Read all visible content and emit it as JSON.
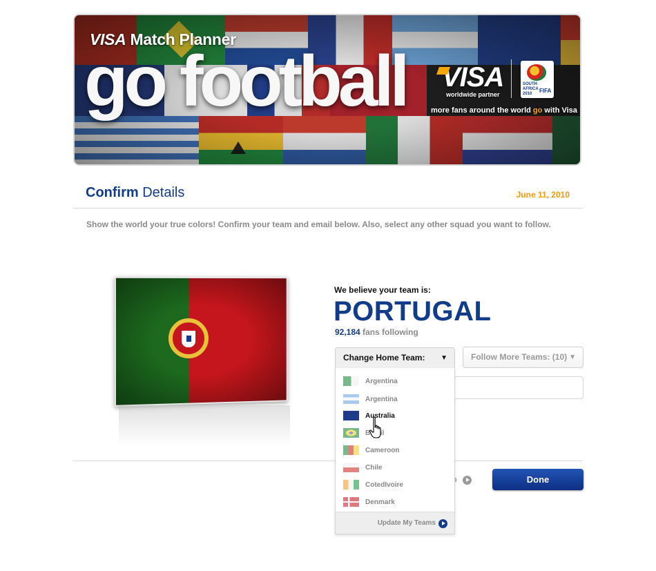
{
  "banner": {
    "visa_word": "VISA",
    "app_name": "Match Planner",
    "headline": "go football",
    "sponsor_logo": "VISA",
    "sponsor_sub": "worldwide partner",
    "tagline_pre": "more fans around the world ",
    "tagline_go": "go",
    "tagline_post": " with Visa",
    "emblem_text": "SOUTH AFRICA 2010",
    "emblem_fifa": "FIFA"
  },
  "header": {
    "title_bold": "Confirm",
    "title_rest": " Details",
    "date": "June 11, 2010"
  },
  "intro": "Show the world your true colors! Confirm your team and email below. Also, select any other squad you want to follow.",
  "team": {
    "believe_label": "We believe your team is:",
    "name": "PORTUGAL",
    "fans_count": "92,184",
    "fans_label": " fans following"
  },
  "controls": {
    "change_home_label": "Change Home Team:",
    "follow_more_label": "Follow More Teams: (10)",
    "arrow": "▼",
    "dropdown_items": [
      {
        "label": "Argentina",
        "flag_icon": "algeria-flag-icon"
      },
      {
        "label": "Argentina",
        "flag_icon": "argentina-flag-icon"
      },
      {
        "label": "Australia",
        "flag_icon": "australia-flag-icon"
      },
      {
        "label": "Brazil",
        "flag_icon": "brazil-flag-icon"
      },
      {
        "label": "Cameroon",
        "flag_icon": "cameroon-flag-icon"
      },
      {
        "label": "Chile",
        "flag_icon": "chile-flag-icon"
      },
      {
        "label": "CotedIvoire",
        "flag_icon": "cotedivoire-flag-icon"
      },
      {
        "label": "Denmark",
        "flag_icon": "denmark-flag-icon"
      }
    ],
    "update_label": "Update My Teams",
    "skip_label": "p",
    "done_label": "Done"
  },
  "colors": {
    "brand_blue": "#123b8a",
    "accent_orange": "#f29b00",
    "portugal_green": "#1d6a1f",
    "portugal_red": "#c4161c"
  }
}
